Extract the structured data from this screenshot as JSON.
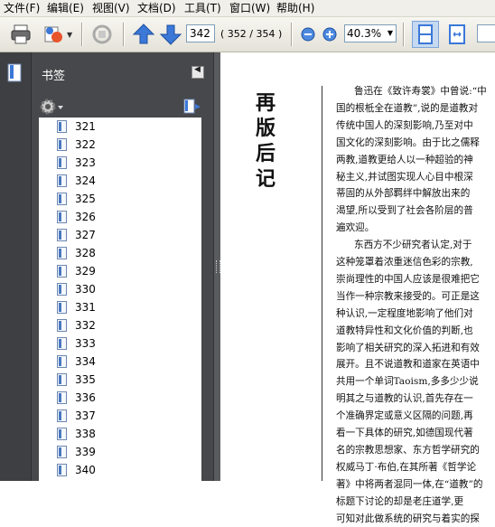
{
  "menu": [
    "文件(F)",
    "编辑(E)",
    "视图(V)",
    "文档(D)",
    "工具(T)",
    "窗口(W)",
    "帮助(H)"
  ],
  "toolbar": {
    "page_input": "342",
    "page_count": "( 352 / 354 )",
    "zoom": "40.3%"
  },
  "bookmarks": {
    "title": "书签",
    "items": [
      "321",
      "322",
      "323",
      "324",
      "325",
      "326",
      "327",
      "328",
      "329",
      "330",
      "331",
      "332",
      "333",
      "334",
      "335",
      "336",
      "337",
      "338",
      "339",
      "340"
    ]
  },
  "page": {
    "title_chars": [
      "再",
      "版",
      "后",
      "记"
    ],
    "lines": [
      "鲁迅在《致许寿裳》中曾说:“中",
      "国的根柢全在道教”,说的是道教对",
      "传统中国人的深刻影响,乃至对中",
      "国文化的深刻影响。由于比之儒释",
      "两教,道教更给人以一种超验的神",
      "秘主义,并试图实现人心目中根深",
      "蒂固的从外部羁绊中解放出来的",
      "渴望,所以受到了社会各阶层的普",
      "遍欢迎。",
      "东西方不少研究者认定,对于",
      "这种笼罩着浓重迷信色彩的宗教,",
      "崇尚理性的中国人应该是很难把它",
      "当作一种宗教来接受的。可正是这",
      "种认识,一定程度地影响了他们对",
      "道教特异性和文化价值的判断,也",
      "影响了相关研究的深入拓进和有效",
      "展开。且不说道教和道家在英语中",
      "共用一个单词Taoism,多多少少说",
      "明其之与道教的认识,首先存在一",
      "个准确界定或意义区隔的问题,再",
      "看一下具体的研究,如德国现代著",
      "名的宗教思想家、东方哲学研究的",
      "权威马丁·布伯,在其所著《哲学论",
      "著》中将两者混同一体,在“道教”的",
      "标题下讨论的却是老庄道学,更",
      "可知对此做系统的研究与着实的探"
    ]
  },
  "colors": {
    "panel": "#47484b",
    "accent_blue": "#3b78d8"
  }
}
